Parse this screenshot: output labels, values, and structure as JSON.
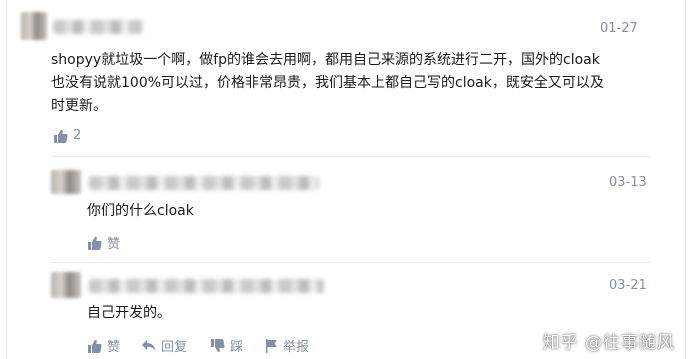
{
  "comment1": {
    "date": "01-27",
    "text_line1": "shopyy就垃圾一个啊，做fp的谁会去用啊，都用自己来源的系统进行二开，国外的cloak",
    "text_line2": "也没有说就100%可以过，价格非常昂贵，我们基本上都自己写的cloak，既安全又可以及",
    "text_line3": "时更新。",
    "like_count": "2"
  },
  "reply1": {
    "date": "03-13",
    "text": "你们的什么cloak",
    "like_label": "赞"
  },
  "reply2": {
    "date": "03-21",
    "text": "自己开发的。",
    "like_label": "赞",
    "reply_label": "回复",
    "dislike_label": "踩",
    "report_label": "举报"
  },
  "watermark": {
    "text": "知乎 @往事随风"
  },
  "icons": {
    "like": "thumbs-up-icon",
    "reply": "reply-arrow-icon",
    "dislike": "thumbs-down-icon",
    "report": "flag-icon",
    "watermark": "mic-icon"
  },
  "colors": {
    "meta_text": "#8590a6",
    "body_text": "#1a1a1a",
    "divider": "#ebebeb"
  }
}
